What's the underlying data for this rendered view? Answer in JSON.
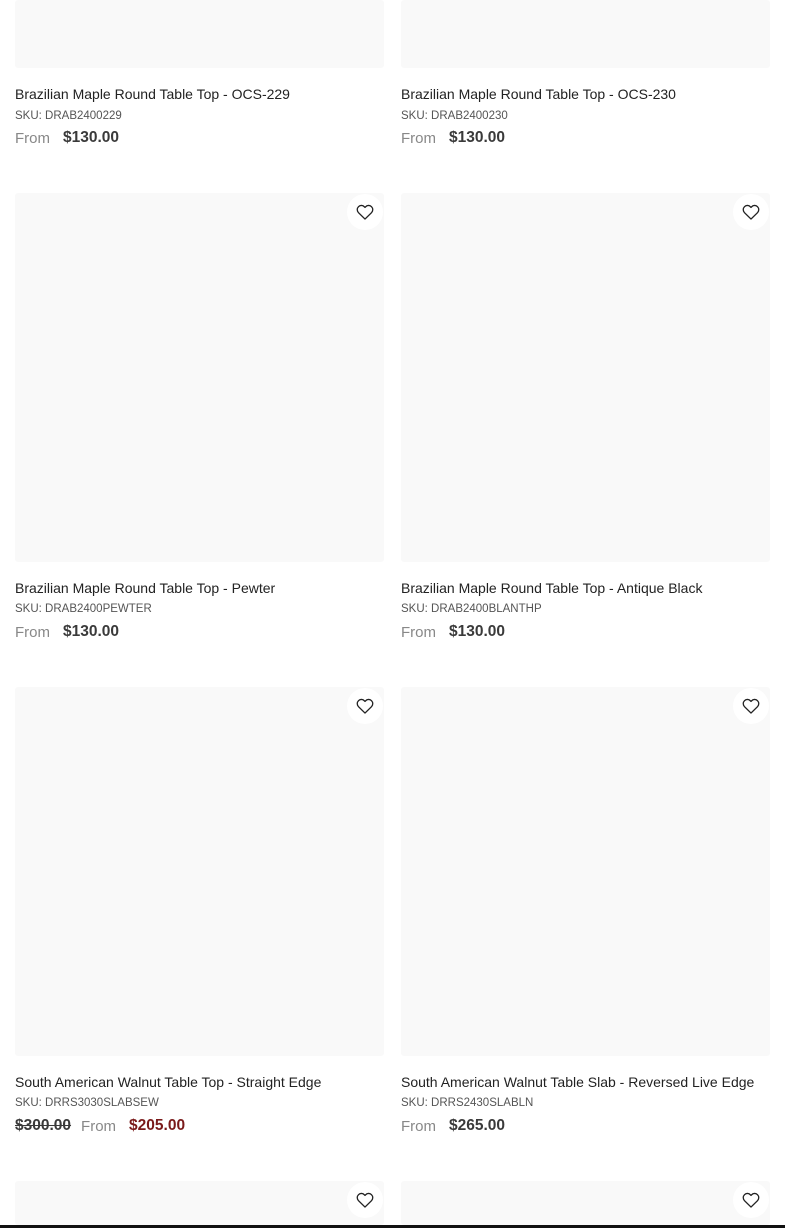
{
  "products": [
    {
      "title": "Brazilian Maple Round Table Top - OCS-229",
      "sku": "SKU: DRAB2400229",
      "from_label": "From",
      "price": "$130.00"
    },
    {
      "title": "Brazilian Maple Round Table Top - OCS-230",
      "sku": "SKU: DRAB2400230",
      "from_label": "From",
      "price": "$130.00"
    },
    {
      "title": "Brazilian Maple Round Table Top - Pewter",
      "sku": "SKU: DRAB2400PEWTER",
      "from_label": "From",
      "price": "$130.00",
      "wishlist_icon": "heart-outline-icon"
    },
    {
      "title": "Brazilian Maple Round Table Top - Antique Black",
      "sku": "SKU: DRAB2400BLANTHP",
      "from_label": "From",
      "price": "$130.00",
      "wishlist_icon": "heart-outline-icon"
    },
    {
      "title": "South American Walnut Table Top - Straight Edge",
      "sku": "SKU: DRRS3030SLABSEW",
      "compare_price": "$300.00",
      "from_label": "From",
      "price": "$205.00",
      "wishlist_icon": "heart-outline-icon"
    },
    {
      "title": "South American Walnut Table Slab - Reversed Live Edge",
      "sku": "SKU: DRRS2430SLABLN",
      "from_label": "From",
      "price": "$265.00",
      "wishlist_icon": "heart-outline-icon"
    },
    {
      "wishlist_icon": "heart-outline-icon"
    },
    {
      "wishlist_icon": "heart-outline-icon"
    }
  ],
  "colors": {
    "image_placeholder": "#f9f9f9",
    "sale_price": "#7a1a1a",
    "text": "#222222",
    "muted": "#888888"
  }
}
